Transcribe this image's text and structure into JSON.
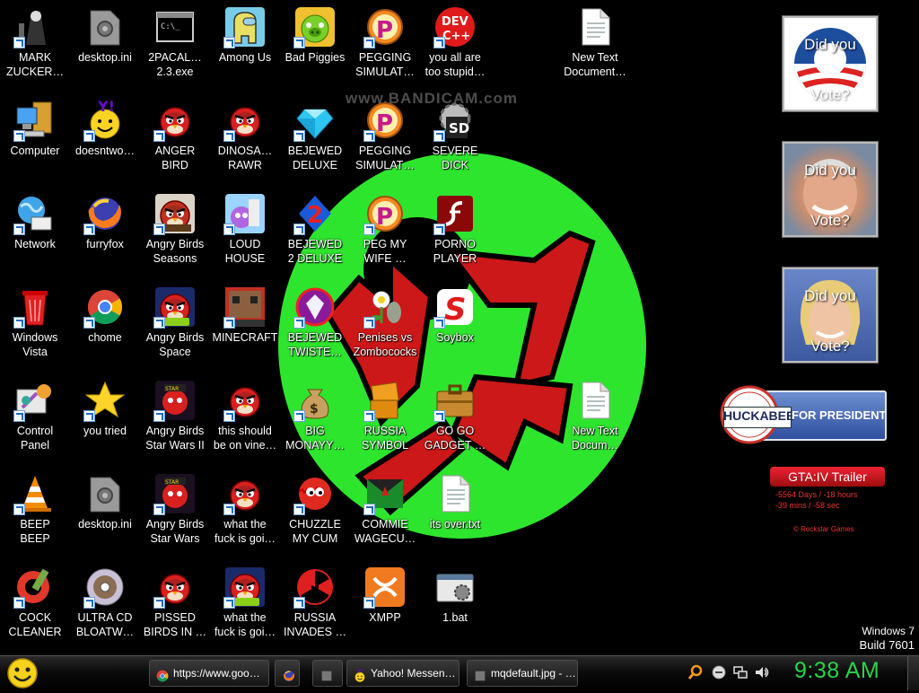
{
  "desktop": {
    "watermark": "www.BANDICAM.com",
    "icons": [
      {
        "label": "MARK\nZUCKER…",
        "icon": "gothic-figure-icon"
      },
      {
        "label": "Computer",
        "icon": "computer-icon"
      },
      {
        "label": "Network",
        "icon": "network-globe-icon"
      },
      {
        "label": "Windows\nVista",
        "icon": "recycle-bin-icon"
      },
      {
        "label": "Control\nPanel",
        "icon": "control-panel-icon"
      },
      {
        "label": "BEEP\nBEEP",
        "icon": "vlc-cone-icon"
      },
      {
        "label": "COCK\nCLEANER",
        "icon": "ccleaner-icon"
      },
      {
        "label": "desktop.ini",
        "icon": "settings-file-icon"
      },
      {
        "label": "doesntwo…",
        "icon": "yahoo-messenger-icon"
      },
      {
        "label": "furryfox",
        "icon": "firefox-icon"
      },
      {
        "label": "chome",
        "icon": "chrome-icon"
      },
      {
        "label": "you tried",
        "icon": "gold-star-icon"
      },
      {
        "label": "desktop.ini",
        "icon": "settings-file-icon"
      },
      {
        "label": "ULTRA CD\nBLOATW…",
        "icon": "cd-disc-icon"
      },
      {
        "label": "2PACAL…\n2.3.exe",
        "icon": "console-window-icon"
      },
      {
        "label": "ANGER\nBIRD",
        "icon": "angry-bird-icon"
      },
      {
        "label": "Angry Birds\nSeasons",
        "icon": "angry-birds-seasons-icon"
      },
      {
        "label": "Angry Birds\nSpace",
        "icon": "angry-birds-space-icon"
      },
      {
        "label": "Angry Birds\nStar Wars II",
        "icon": "angry-birds-star-wars-icon"
      },
      {
        "label": "Angry Birds\nStar Wars",
        "icon": "angry-birds-star-wars-icon"
      },
      {
        "label": "PISSED\nBIRDS IN …",
        "icon": "angry-bird-icon"
      },
      {
        "label": "Among Us",
        "icon": "among-us-icon"
      },
      {
        "label": "DINOSA…\nRAWR",
        "icon": "angry-bird-icon"
      },
      {
        "label": "LOUD\nHOUSE",
        "icon": "angry-bird-game-icon"
      },
      {
        "label": "MINECRAFT",
        "icon": "minecraft-icon"
      },
      {
        "label": "this should\nbe on vine…",
        "icon": "angry-bird-icon"
      },
      {
        "label": "what the\nfuck is goi…",
        "icon": "angry-bird-icon"
      },
      {
        "label": "what the\nfuck is goi…",
        "icon": "angry-birds-space-icon"
      },
      {
        "label": "Bad Piggies",
        "icon": "bad-piggies-icon"
      },
      {
        "label": "BEJEWED\nDELUXE",
        "icon": "diamond-icon"
      },
      {
        "label": "BEJEWED\n2 DELUXE",
        "icon": "bejeweled-2-icon"
      },
      {
        "label": "BEJEWED\nTWISTE…",
        "icon": "bejeweled-twist-icon"
      },
      {
        "label": "BIG\nMONAYY…",
        "icon": "money-bag-icon"
      },
      {
        "label": "CHUZZLE\nMY CUM",
        "icon": "chuzzle-icon"
      },
      {
        "label": "RUSSIA\nINVADES …",
        "icon": "radiation-icon"
      },
      {
        "label": "PEGGING\nSIMULAT…",
        "icon": "peggle-icon"
      },
      {
        "label": "PEGGING\nSIMULAT…",
        "icon": "peggle-icon"
      },
      {
        "label": "PEG MY\nWIFE …",
        "icon": "peggle-icon"
      },
      {
        "label": "Penises vs\nZombococks",
        "icon": "plants-vs-zombies-icon"
      },
      {
        "label": "RUSSIA\nSYMBOL",
        "icon": "orange-block-icon"
      },
      {
        "label": "COMMIE\nWAGECU…",
        "icon": "commie-flag-icon"
      },
      {
        "label": "XMPP",
        "icon": "xampp-icon"
      },
      {
        "label": "you all are\ntoo stupid…",
        "icon": "dev-cpp-icon"
      },
      {
        "label": "SEVERE\nDICK",
        "icon": "sd-gear-icon"
      },
      {
        "label": "PORNO\nPLAYER",
        "icon": "flash-player-icon"
      },
      {
        "label": "Soybox",
        "icon": "soybox-icon"
      },
      {
        "label": "GO GO\nGADGET …",
        "icon": "briefcase-icon"
      },
      {
        "label": "its over.txt",
        "icon": "text-file-icon"
      },
      {
        "label": "1.bat",
        "icon": "batch-file-icon"
      },
      {
        "label": "New Text\nDocument…",
        "icon": "text-file-icon"
      },
      {
        "label": "New Text\nDocum…",
        "icon": "text-file-icon"
      }
    ]
  },
  "gadgets": {
    "vote": [
      {
        "line1": "Did you",
        "line2": "Vote?",
        "icon": "obama-logo-icon"
      },
      {
        "line1": "Did you",
        "line2": "Vote?",
        "icon": "mccain-portrait-icon"
      },
      {
        "line1": "Did you",
        "line2": "Vote?",
        "icon": "clinton-portrait-icon"
      }
    ],
    "huckabee": {
      "name": "HUCKABEE",
      "tagline": "FOR PRESIDENT"
    },
    "gta": {
      "title": "GTA:IV Trailer",
      "line1": "-5564 Days / -18 hours",
      "line2": "-39 mins / -58 sec",
      "footer": "© Rockstar Games"
    }
  },
  "os": {
    "name": "Windows 7",
    "build": "Build 7601"
  },
  "taskbar": {
    "buttons": [
      {
        "label": "https://www.goo…",
        "icon": "chrome-icon"
      },
      {
        "label": "",
        "icon": "firefox-icon"
      },
      {
        "label": "",
        "icon": "folder-icon"
      },
      {
        "label": "Yahoo! Messen…",
        "icon": "yahoo-messenger-icon"
      },
      {
        "label": "mqdefault.jpg - …",
        "icon": "image-viewer-icon"
      }
    ],
    "clock": "9:38 AM"
  }
}
